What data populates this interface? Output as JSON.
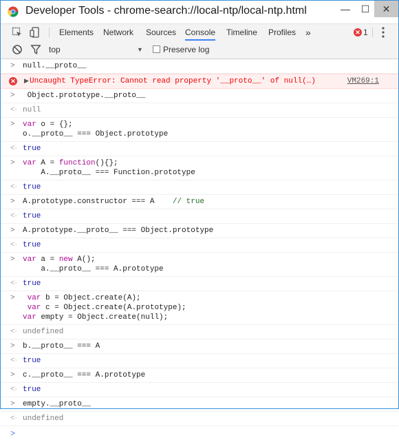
{
  "window": {
    "title": "Developer Tools - chrome-search://local-ntp/local-ntp.html",
    "minimize": "—",
    "maximize": "☐",
    "close": "✕"
  },
  "tabs": [
    {
      "label": "Elements"
    },
    {
      "label": "Network"
    },
    {
      "label": "Sources"
    },
    {
      "label": "Console",
      "active": true
    },
    {
      "label": "Timeline"
    },
    {
      "label": "Profiles"
    }
  ],
  "overflow": "»",
  "errors": {
    "count": "1"
  },
  "toolbar": {
    "context": "top",
    "preserve_log": "Preserve log"
  },
  "console": {
    "m1": "null.__proto__",
    "err_text": "Uncaught TypeError: Cannot read property '__proto__' of null(…)",
    "err_src": "VM269:1",
    "m2": " Object.prototype.__proto__",
    "r2": "null",
    "m3a_kw": "var",
    "m3a": " o = {};",
    "m3b": "o.__proto__ === Object.prototype",
    "r3": "true",
    "m4a_kw1": "var",
    "m4a_mid": " A = ",
    "m4a_kw2": "function",
    "m4a_end": "(){};",
    "m4b": "    A.__proto__ === Function.prototype",
    "r4": "true",
    "m5": "A.prototype.constructor === A    ",
    "m5_cmt": "// true",
    "r5": "true",
    "m6": "A.prototype.__proto__ === Object.prototype",
    "r6": "true",
    "m7a_kw": "var",
    "m7a_mid": " a = ",
    "m7a_kw2": "new",
    "m7a_end": " A();",
    "m7b": "    a.__proto__ === A.prototype",
    "r7": "true",
    "m8a_pre": " ",
    "m8a_kw": "var",
    "m8a": " b = Object.create(A);",
    "m8b_kw": "var",
    "m8b": " c = Object.create(A.prototype);",
    "m8c_kw": "var",
    "m8c": " empty = Object.create(null);",
    "r8": "undefined",
    "m9": "b.__proto__ === A",
    "r9": "true",
    "m10": "c.__proto__ === A.prototype",
    "r10": "true",
    "m11": "empty.__proto__",
    "r11": "undefined"
  },
  "colors": {
    "accent": "#3e82f7",
    "error": "#e23b3b",
    "keyword": "#aa0d91",
    "comment": "#236e25",
    "result": "#1a1aa6"
  }
}
